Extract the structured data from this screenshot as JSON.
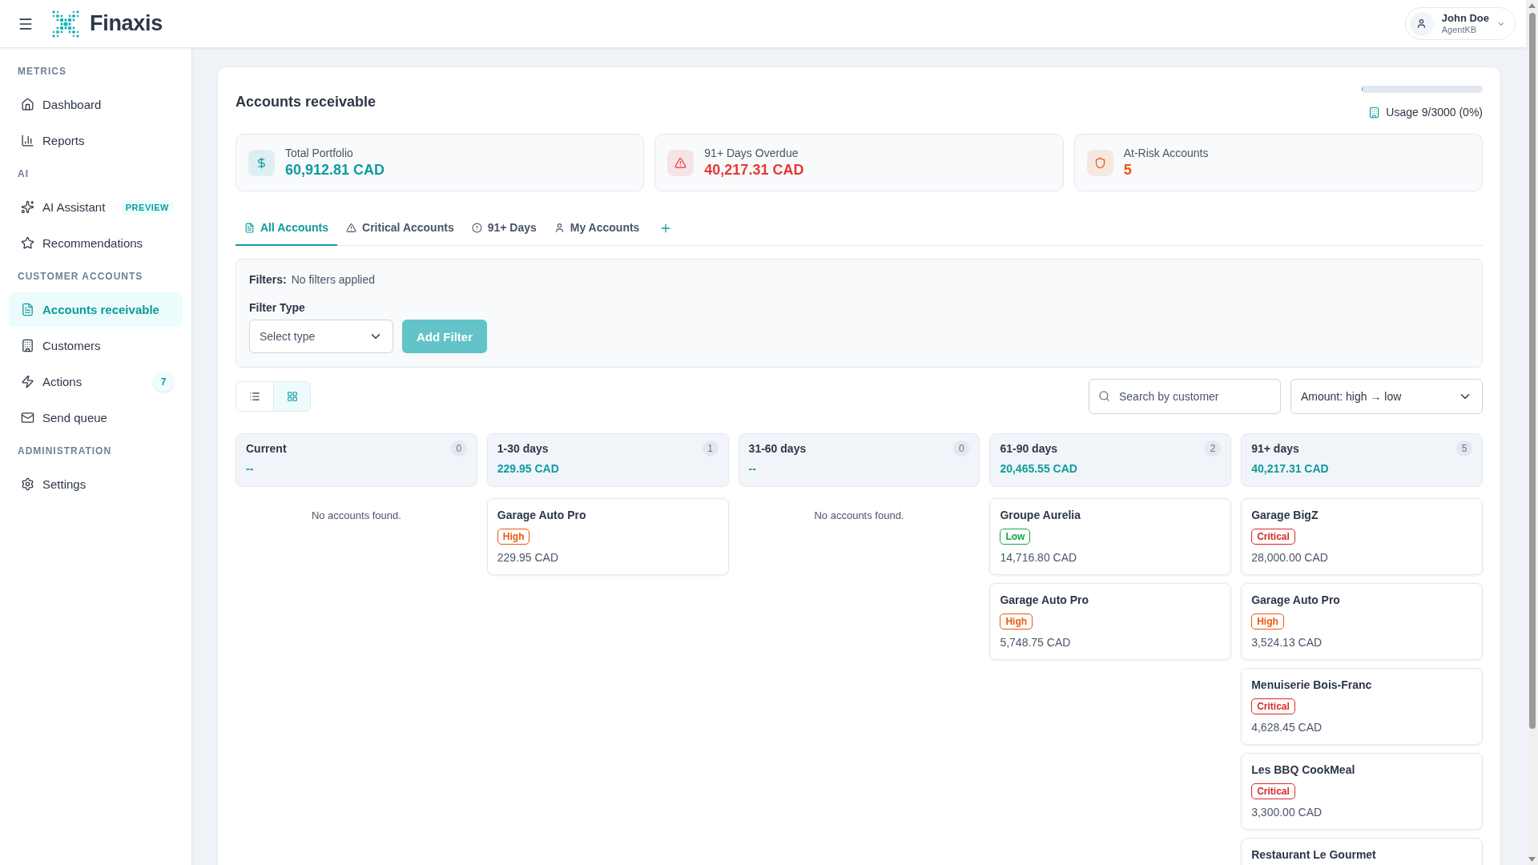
{
  "header": {
    "brand": "Finaxis",
    "user": {
      "name": "John Doe",
      "role": "AgentKB"
    }
  },
  "sidebar": {
    "sections": [
      {
        "title": "METRICS",
        "items": [
          {
            "label": "Dashboard",
            "selected": false
          },
          {
            "label": "Reports",
            "selected": false
          }
        ]
      },
      {
        "title": "AI",
        "items": [
          {
            "label": "AI Assistant",
            "tag": "PREVIEW",
            "selected": false
          },
          {
            "label": "Recommendations",
            "selected": false
          }
        ]
      },
      {
        "title": "CUSTOMER ACCOUNTS",
        "items": [
          {
            "label": "Accounts receivable",
            "selected": true
          },
          {
            "label": "Customers",
            "selected": false
          },
          {
            "label": "Actions",
            "count": "7",
            "selected": false
          },
          {
            "label": "Send queue",
            "selected": false
          }
        ]
      },
      {
        "title": "ADMINISTRATION",
        "items": [
          {
            "label": "Settings",
            "selected": false
          }
        ]
      }
    ]
  },
  "page": {
    "title": "Accounts receivable",
    "usage": {
      "label": "Usage 9/3000 (0%)",
      "level": 0.003
    }
  },
  "stats": [
    {
      "label": "Total Portfolio",
      "value": "60,912.81 CAD",
      "color": "#0f9b9e"
    },
    {
      "label": "91+ Days Overdue",
      "value": "40,217.31 CAD",
      "color": "#e53935"
    },
    {
      "label": "At-Risk Accounts",
      "value": "5",
      "color": "#ea580c"
    }
  ],
  "tabs": [
    {
      "label": "All Accounts",
      "selected": true
    },
    {
      "label": "Critical Accounts",
      "selected": false
    },
    {
      "label": "91+ Days",
      "selected": false
    },
    {
      "label": "My Accounts",
      "selected": false
    }
  ],
  "filters": {
    "label": "Filters:",
    "value": "No filters applied",
    "type_label": "Filter Type",
    "type_select": {
      "placeholder": "Select type"
    },
    "add_button": "Add Filter"
  },
  "toolbar": {
    "view_modes": [
      {
        "kind": "list",
        "selected": false
      },
      {
        "kind": "grid",
        "selected": true
      }
    ],
    "search": {
      "placeholder": "Search by customer"
    },
    "sort": {
      "value": "Amount: high → low"
    }
  },
  "board": {
    "columns": [
      {
        "title": "Current",
        "count": "0",
        "amount": "--",
        "empty_message": "No accounts found."
      },
      {
        "title": "1-30 days",
        "count": "1",
        "amount": "229.95 CAD",
        "accounts": [
          {
            "name": "Garage Auto Pro",
            "priority": "High",
            "color": "#ea580c",
            "amount": "229.95 CAD"
          }
        ]
      },
      {
        "title": "31-60 days",
        "count": "0",
        "amount": "--",
        "empty_message": "No accounts found."
      },
      {
        "title": "61-90 days",
        "count": "2",
        "amount": "20,465.55 CAD",
        "accounts": [
          {
            "name": "Groupe Aurelia",
            "priority": "Low",
            "color": "#16a34a",
            "amount": "14,716.80 CAD"
          },
          {
            "name": "Garage Auto Pro",
            "priority": "High",
            "color": "#ea580c",
            "amount": "5,748.75 CAD"
          }
        ]
      },
      {
        "title": "91+ days",
        "count": "5",
        "amount": "40,217.31 CAD",
        "accounts": [
          {
            "name": "Garage BigZ",
            "priority": "Critical",
            "color": "#dc2626",
            "amount": "28,000.00 CAD"
          },
          {
            "name": "Garage Auto Pro",
            "priority": "High",
            "color": "#ea580c",
            "amount": "3,524.13 CAD"
          },
          {
            "name": "Menuiserie Bois-Franc",
            "priority": "Critical",
            "color": "#dc2626",
            "amount": "4,628.45 CAD"
          },
          {
            "name": "Les BBQ CookMeal",
            "priority": "Critical",
            "color": "#dc2626",
            "amount": "3,300.00 CAD"
          },
          {
            "name": "Restaurant Le Gourmet"
          }
        ]
      }
    ]
  }
}
